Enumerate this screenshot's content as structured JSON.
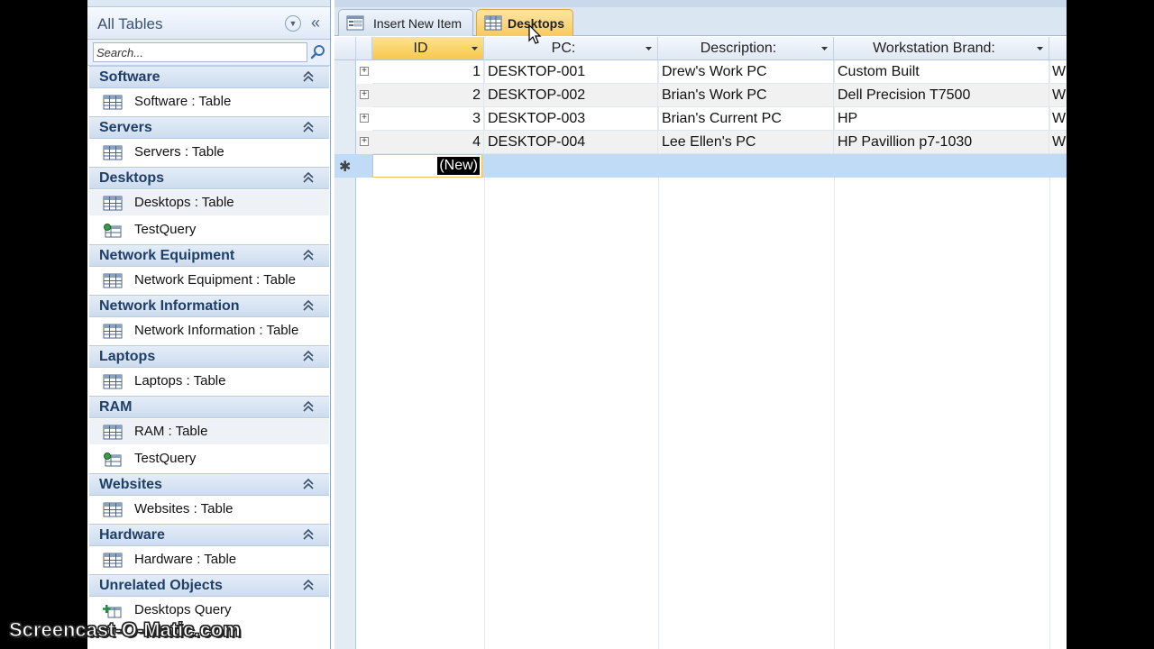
{
  "nav": {
    "title": "All Tables",
    "search_placeholder": "Search...",
    "groups": [
      {
        "label": "Software",
        "items": [
          {
            "label": "Software : Table",
            "icon": "table-icon"
          }
        ]
      },
      {
        "label": "Servers",
        "items": [
          {
            "label": "Servers : Table",
            "icon": "table-icon"
          }
        ]
      },
      {
        "label": "Desktops",
        "items": [
          {
            "label": "Desktops : Table",
            "icon": "table-icon"
          },
          {
            "label": "TestQuery",
            "icon": "query-icon"
          }
        ]
      },
      {
        "label": "Network Equipment",
        "items": [
          {
            "label": "Network Equipment : Table",
            "icon": "table-icon"
          }
        ]
      },
      {
        "label": "Network Information",
        "items": [
          {
            "label": "Network Information : Table",
            "icon": "table-icon"
          }
        ]
      },
      {
        "label": "Laptops",
        "items": [
          {
            "label": "Laptops : Table",
            "icon": "table-icon"
          }
        ]
      },
      {
        "label": "RAM",
        "items": [
          {
            "label": "RAM : Table",
            "icon": "table-icon"
          },
          {
            "label": "TestQuery",
            "icon": "query-icon"
          }
        ]
      },
      {
        "label": "Websites",
        "items": [
          {
            "label": "Websites : Table",
            "icon": "table-icon"
          }
        ]
      },
      {
        "label": "Hardware",
        "items": [
          {
            "label": "Hardware : Table",
            "icon": "table-icon"
          }
        ]
      },
      {
        "label": "Unrelated Objects",
        "items": [
          {
            "label": "Desktops Query",
            "icon": "append-query-icon"
          }
        ]
      }
    ]
  },
  "tabs": [
    {
      "label": "Insert New Item",
      "icon": "form-icon",
      "active": false
    },
    {
      "label": "Desktops",
      "icon": "table-icon",
      "active": true
    }
  ],
  "grid": {
    "columns": [
      "ID",
      "PC:",
      "Description:",
      "Workstation Brand:"
    ],
    "rows": [
      {
        "id": "1",
        "pc": "DESKTOP-001",
        "description": "Drew's Work PC",
        "brand": "Custom Built",
        "next": "W"
      },
      {
        "id": "2",
        "pc": "DESKTOP-002",
        "description": "Brian's Work PC",
        "brand": "Dell Precision T7500",
        "next": "W"
      },
      {
        "id": "3",
        "pc": "DESKTOP-003",
        "description": "Brian's Current PC",
        "brand": "HP",
        "next": "W"
      },
      {
        "id": "4",
        "pc": "DESKTOP-004",
        "description": "Lee Ellen's PC",
        "brand": "HP Pavillion p7-1030",
        "next": "W"
      }
    ],
    "new_row_label": "(New)",
    "new_row_marker": "✱"
  },
  "watermark": "Screencast-O-Matic.com",
  "colors": {
    "accent": "#f8c74f",
    "group_text": "#1f3f66",
    "new_row": "#c0dbf5"
  }
}
